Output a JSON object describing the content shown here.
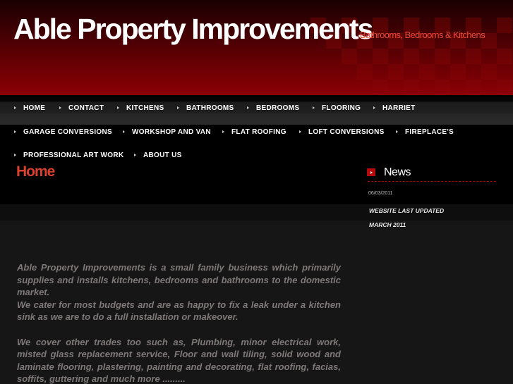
{
  "header": {
    "site_title": "Able Property Improvements",
    "tagline": "Bathrooms, Bedrooms & Kitchens",
    "brand_color": "#8a0004",
    "tagline_color": "#ef4a36"
  },
  "nav": {
    "rows": [
      [
        {
          "label": "HOME",
          "icon": "arrow-right-icon"
        },
        {
          "label": "CONTACT",
          "icon": "arrow-right-icon"
        },
        {
          "label": "KITCHENS",
          "icon": "arrow-right-icon"
        },
        {
          "label": "BATHROOMS",
          "icon": "arrow-right-icon"
        },
        {
          "label": "BEDROOMS",
          "icon": "arrow-right-icon"
        },
        {
          "label": "FLOORING",
          "icon": "arrow-right-icon"
        },
        {
          "label": "HARRIET",
          "icon": "arrow-right-icon"
        }
      ],
      [
        {
          "label": "GARAGE CONVERSIONS",
          "icon": "arrow-right-icon"
        },
        {
          "label": "WORKSHOP AND VAN",
          "icon": "arrow-right-icon"
        },
        {
          "label": "FLAT ROOFING",
          "icon": "arrow-right-icon"
        },
        {
          "label": "LOFT CONVERSIONS",
          "icon": "arrow-right-icon"
        },
        {
          "label": "FIREPLACE'S",
          "icon": "arrow-right-icon"
        }
      ],
      [
        {
          "label": "PROFESSIONAL ART WORK",
          "icon": "arrow-right-icon"
        },
        {
          "label": "ABOUT US",
          "icon": "arrow-right-icon"
        }
      ]
    ]
  },
  "main": {
    "page_title": "Home",
    "title_color": "#d8412e",
    "paragraphs": [
      "Able Property Improvements is a small family business which primarily supplies and installs kitchens, bedrooms and bathrooms to the domestic market.",
      "We cater for most budgets and are as happy to fix a leak under a kitchen sink as we are to do a full installation or makeover.",
      "We cover other trades too such as, Plumbing, minor electrical work, misted glass replacement service, Floor and wall tiling, solid wood and laminate flooring, plastering, painting and decorating, flat roofing, facias, soffits, guttering and much more ........."
    ]
  },
  "news": {
    "title": "News",
    "icon": "play-arrow-icon",
    "date": "06/03/2011",
    "items": [
      "WEBSITE LAST UPDATED",
      "MARCH 2011"
    ]
  }
}
